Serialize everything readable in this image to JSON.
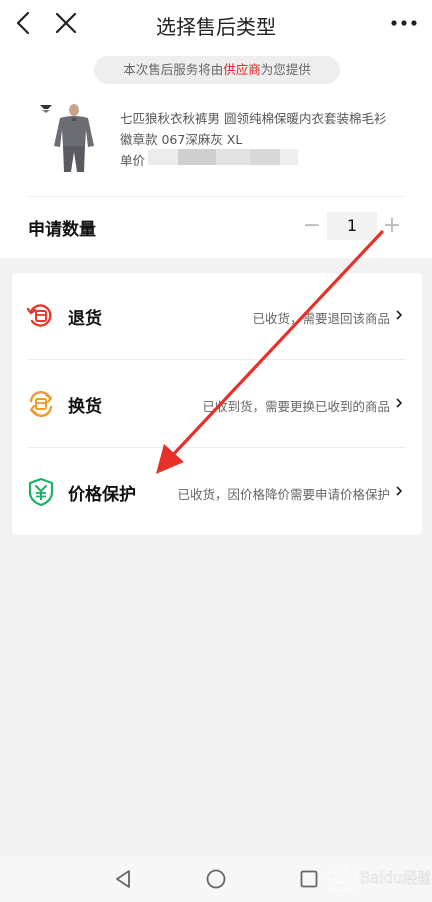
{
  "header": {
    "title": "选择售后类型"
  },
  "notice": {
    "prefix": "本次售后服务将由",
    "highlight": "供应商",
    "suffix": "为您提供",
    "highlight_color": "#e02020"
  },
  "product": {
    "name": "七匹狼秋衣秋裤男 圆领纯棉保暖内衣套装棉毛衫 徽章款 067深麻灰 XL",
    "price_label": "单价"
  },
  "quantity": {
    "label": "申请数量",
    "minus": "−",
    "value": "1",
    "plus": "+"
  },
  "options": [
    {
      "label": "退货",
      "desc": "已收货，需要退回该商品",
      "icon": "return-icon",
      "color": "#e8382f"
    },
    {
      "label": "换货",
      "desc": "已收到货，需要更换已收到的商品",
      "icon": "exchange-icon",
      "color": "#f39a2e"
    },
    {
      "label": "价格保护",
      "desc": "已收货，因价格降价需要申请价格保护",
      "icon": "price-protect-icon",
      "color": "#1bb06a"
    }
  ],
  "watermark": {
    "text": "Baidu经验"
  }
}
